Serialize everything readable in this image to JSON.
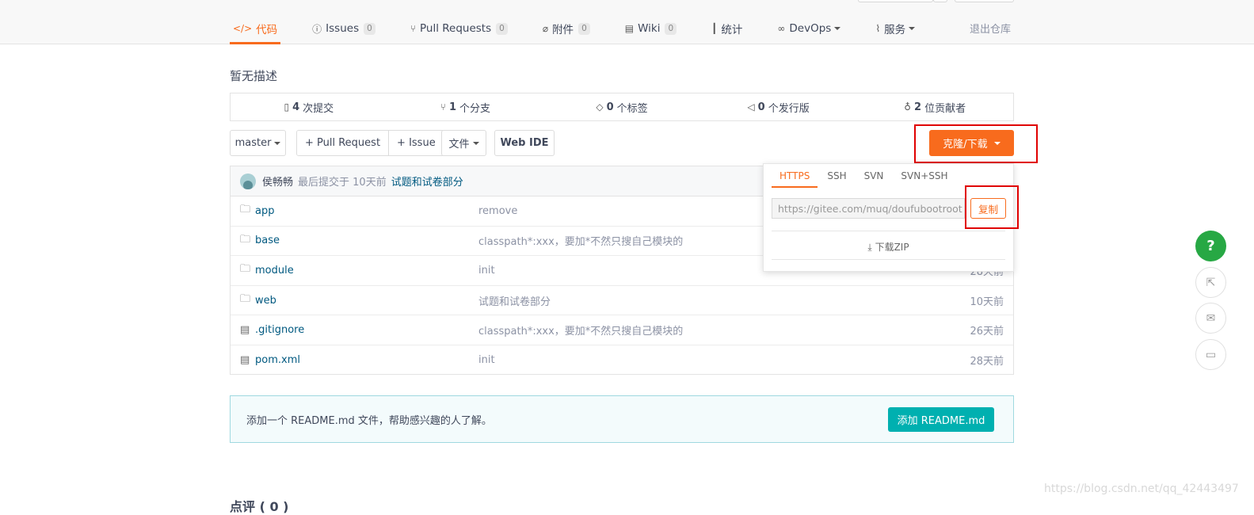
{
  "nav": {
    "tabs": [
      {
        "label": "代码",
        "icon": "code-icon",
        "count": null,
        "active": true
      },
      {
        "label": "Issues",
        "icon": "issue-icon",
        "count": "0"
      },
      {
        "label": "Pull Requests",
        "icon": "pull-request-icon",
        "count": "0"
      },
      {
        "label": "附件",
        "icon": "paperclip-icon",
        "count": "0"
      },
      {
        "label": "Wiki",
        "icon": "book-icon",
        "count": "0"
      },
      {
        "label": "统计",
        "icon": "bar-chart-icon",
        "count": null
      },
      {
        "label": "DevOps",
        "icon": "infinity-icon",
        "dropdown": true
      },
      {
        "label": "服务",
        "icon": "pulse-icon",
        "dropdown": true
      }
    ],
    "exit_label": "退出仓库"
  },
  "repo": {
    "description": "暂无描述",
    "stats": [
      {
        "count": "4",
        "label": "次提交",
        "icon": "commit-icon"
      },
      {
        "count": "1",
        "label": "个分支",
        "icon": "branch-icon"
      },
      {
        "count": "0",
        "label": "个标签",
        "icon": "tag-icon"
      },
      {
        "count": "0",
        "label": "个发行版",
        "icon": "release-icon"
      },
      {
        "count": "2",
        "label": "位贡献者",
        "icon": "contributors-icon"
      }
    ]
  },
  "toolbar": {
    "branch": "master",
    "pull_request": "+ Pull Request",
    "issue": "+ Issue",
    "file": "文件",
    "web_ide": "Web IDE",
    "clone": "克隆/下载"
  },
  "commit": {
    "author": "侯畅畅",
    "meta": "最后提交于 10天前",
    "message": "试题和试卷部分"
  },
  "files": [
    {
      "type": "folder",
      "name": "app",
      "message": "remove",
      "time": ""
    },
    {
      "type": "folder",
      "name": "base",
      "message": "classpath*:xxx，要加*不然只搜自己模块的",
      "time": ""
    },
    {
      "type": "folder",
      "name": "module",
      "message": "init",
      "time": "28天前"
    },
    {
      "type": "folder",
      "name": "web",
      "message": "试题和试卷部分",
      "time": "10天前"
    },
    {
      "type": "file",
      "name": ".gitignore",
      "message": "classpath*:xxx，要加*不然只搜自己模块的",
      "time": "26天前"
    },
    {
      "type": "file",
      "name": "pom.xml",
      "message": "init",
      "time": "28天前"
    }
  ],
  "clone_popup": {
    "tabs": [
      "HTTPS",
      "SSH",
      "SVN",
      "SVN+SSH"
    ],
    "url": "https://gitee.com/muq/doufubootroot",
    "copy": "复制",
    "download_zip": "下载ZIP"
  },
  "readme": {
    "text": "添加一个 README.md 文件，帮助感兴趣的人了解。",
    "button": "添加 README.md"
  },
  "comments_heading": "点评 ( 0 )",
  "watermark": "https://blog.csdn.net/qq_42443497",
  "colors": {
    "accent": "#f86b1d",
    "link": "#005980",
    "teal": "#00b0b0",
    "green": "#27a844",
    "highlight": "#e00000"
  }
}
